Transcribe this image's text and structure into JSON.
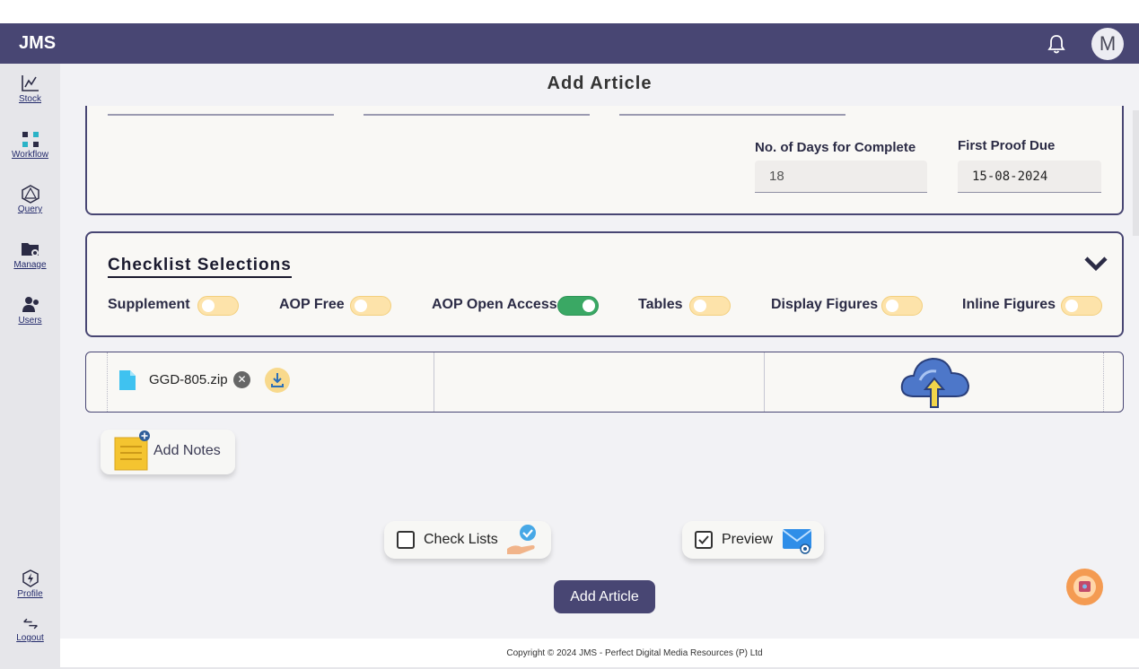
{
  "app": {
    "brand": "JMS",
    "avatar_initial": "M"
  },
  "sidebar": {
    "items": [
      {
        "label": "Stock",
        "icon": "chart-icon"
      },
      {
        "label": "Workflow",
        "icon": "workflow-icon"
      },
      {
        "label": "Query",
        "icon": "query-icon"
      },
      {
        "label": "Manage",
        "icon": "folder-gear-icon"
      },
      {
        "label": "Users",
        "icon": "users-icon"
      }
    ],
    "bottom": [
      {
        "label": "Profile",
        "icon": "profile-icon"
      },
      {
        "label": "Logout",
        "icon": "logout-icon"
      }
    ]
  },
  "page": {
    "title": "Add Article"
  },
  "schedule": {
    "days_label": "No. of Days for Complete",
    "days_value": "18",
    "proof_label": "First Proof Due",
    "proof_value": "15-08-2024"
  },
  "checklist": {
    "title": "Checklist Selections",
    "toggles": [
      {
        "label": "Supplement",
        "on": false
      },
      {
        "label": "AOP Free",
        "on": false
      },
      {
        "label": "AOP Open Access",
        "on": true
      },
      {
        "label": "Tables",
        "on": false
      },
      {
        "label": "Display Figures",
        "on": false
      },
      {
        "label": "Inline Figures",
        "on": false
      }
    ]
  },
  "upload": {
    "file_name": "GGD-805.zip",
    "remove_glyph": "✕"
  },
  "notes": {
    "label": "Add Notes"
  },
  "options": {
    "checklists": {
      "label": "Check Lists",
      "checked": false
    },
    "preview": {
      "label": "Preview",
      "checked": true
    }
  },
  "submit": {
    "label": "Add Article"
  },
  "footer": {
    "copyright": "Copyright © 2024 JMS - Perfect Digital Media Resources (P) Ltd"
  },
  "colors": {
    "primary": "#484673",
    "toggle_off": "#fde3aa",
    "toggle_on": "#3aa864",
    "accent": "#f49b52"
  }
}
